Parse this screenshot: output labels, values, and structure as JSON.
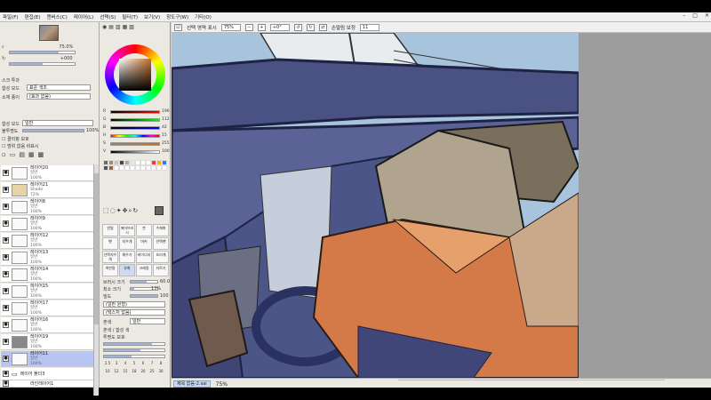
{
  "menu": [
    "파일(F)",
    "편집(E)",
    "캔버스(C)",
    "레이어(L)",
    "선택(S)",
    "필터(T)",
    "보기(V)",
    "창도구(W)",
    "기타(O)"
  ],
  "toolbar": {
    "selection_label": "선택 영역 표시",
    "zoom": "75%",
    "rotation": "+0°",
    "stabilizer_label": "손떨림 보정",
    "stabilizer_value": "11"
  },
  "navigator": {
    "zoom": "75.0%",
    "angle": "+0°",
    "rotate": "+000"
  },
  "layer_props": {
    "section": "스크 투과",
    "blend_label": "합성 모드",
    "blend_value": "표준 색조",
    "bind_label": "소재 종이",
    "bind_value": "(효과 없음)",
    "mode_label": "합성 모드",
    "mode_value": "일반",
    "opacity_label": "불투명도",
    "opacity_value": "100%",
    "check1": "클리핑 보호",
    "check2": "범위 없음 비표시"
  },
  "layers": [
    {
      "name": "레이어20",
      "mode": "일반",
      "opacity": "100%"
    },
    {
      "name": "레이어21",
      "mode": "Shade",
      "opacity": "72%"
    },
    {
      "name": "레이어8",
      "mode": "일반",
      "opacity": "100%"
    },
    {
      "name": "레이어9",
      "mode": "일반",
      "opacity": "100%"
    },
    {
      "name": "레이어12",
      "mode": "일반",
      "opacity": "100%"
    },
    {
      "name": "레이어13",
      "mode": "일반",
      "opacity": "100%"
    },
    {
      "name": "레이어14",
      "mode": "일반",
      "opacity": "100%"
    },
    {
      "name": "레이어15",
      "mode": "일반",
      "opacity": "100%"
    },
    {
      "name": "레이어17",
      "mode": "일반",
      "opacity": "100%"
    },
    {
      "name": "레이어16",
      "mode": "일반",
      "opacity": "100%"
    },
    {
      "name": "레이어19",
      "mode": "일반",
      "opacity": "100%"
    },
    {
      "name": "레이어11",
      "mode": "일반",
      "opacity": "100%"
    },
    {
      "name": "레이어 폴더3",
      "mode": "",
      "opacity": ""
    },
    {
      "name": "라인레이어1",
      "mode": "일반",
      "opacity": "100%"
    }
  ],
  "color": {
    "current": "#c4702a",
    "channels": [
      {
        "label": "R",
        "value": "196"
      },
      {
        "label": "G",
        "value": "112"
      },
      {
        "label": "B",
        "value": "42"
      },
      {
        "label": "H",
        "value": "15"
      },
      {
        "label": "S",
        "value": "255"
      },
      {
        "label": "V",
        "value": "100"
      }
    ]
  },
  "tools": [
    "연필",
    "에어브러시",
    "붓",
    "수채화",
    "펜",
    "지우개",
    "마커",
    "선택펜",
    "선택지우개",
    "채우기",
    "바이너리",
    "흐리게",
    "색연필",
    "유화",
    "크레용",
    "자르기"
  ],
  "brush": {
    "size_label": "브러시 크기",
    "size_value": "60.0",
    "min_label": "최소 크기",
    "min_value": "13%",
    "density_label": "밀도",
    "density_value": "100",
    "shape_label": "(일반 원형)",
    "texture_label": "(텍스처 없음)",
    "blend_label": "혼색",
    "blend_value": "일반",
    "opt1": "혼색 / 합성 색",
    "opt2": "투명도 보호"
  },
  "brush_sizes": [
    "2.5",
    "3",
    "4",
    "5",
    "6",
    "7",
    "8",
    "10",
    "12",
    "15",
    "18",
    "20",
    "25",
    "30"
  ],
  "status": {
    "tab": "제목 없음-2.sai",
    "zoom": "75%"
  }
}
